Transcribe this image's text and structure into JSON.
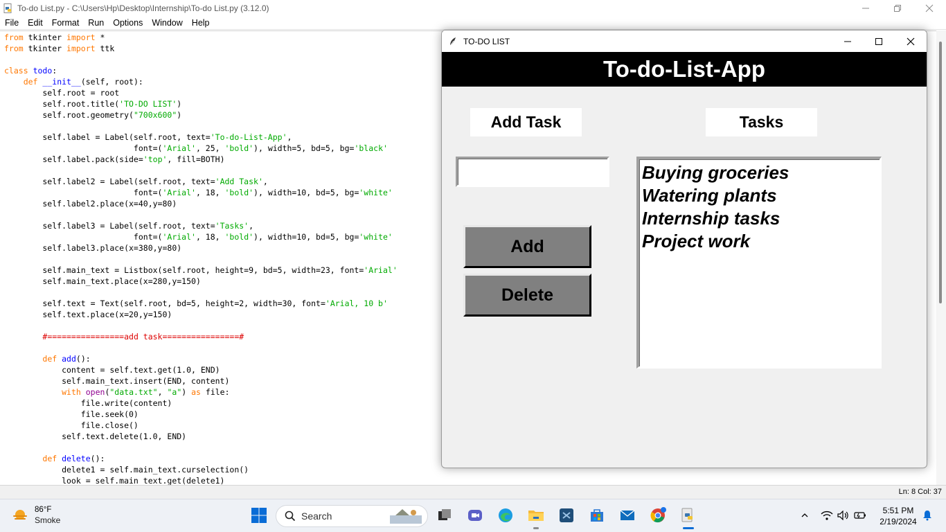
{
  "idle": {
    "title": "To-do List.py - C:\\Users\\Hp\\Desktop\\Internship\\To-do List.py (3.12.0)",
    "menu": [
      "File",
      "Edit",
      "Format",
      "Run",
      "Options",
      "Window",
      "Help"
    ],
    "status": "Ln: 8    Col: 37"
  },
  "tk": {
    "title": "TO-DO LIST",
    "header": "To-do-List-App",
    "add_task_label": "Add Task",
    "tasks_label": "Tasks",
    "entry_value": "",
    "add_button": "Add",
    "delete_button": "Delete",
    "tasks": [
      "Buying groceries",
      "Watering plants",
      "Internship tasks",
      "Project work"
    ]
  },
  "taskbar": {
    "weather_temp": "86°F",
    "weather_condition": "Smoke",
    "search_label": "Search",
    "time": "5:51 PM",
    "date": "2/19/2024"
  },
  "colors": {
    "header_bg": "#000000",
    "button_bg": "#808080",
    "window_bg": "#f0f0f0"
  }
}
